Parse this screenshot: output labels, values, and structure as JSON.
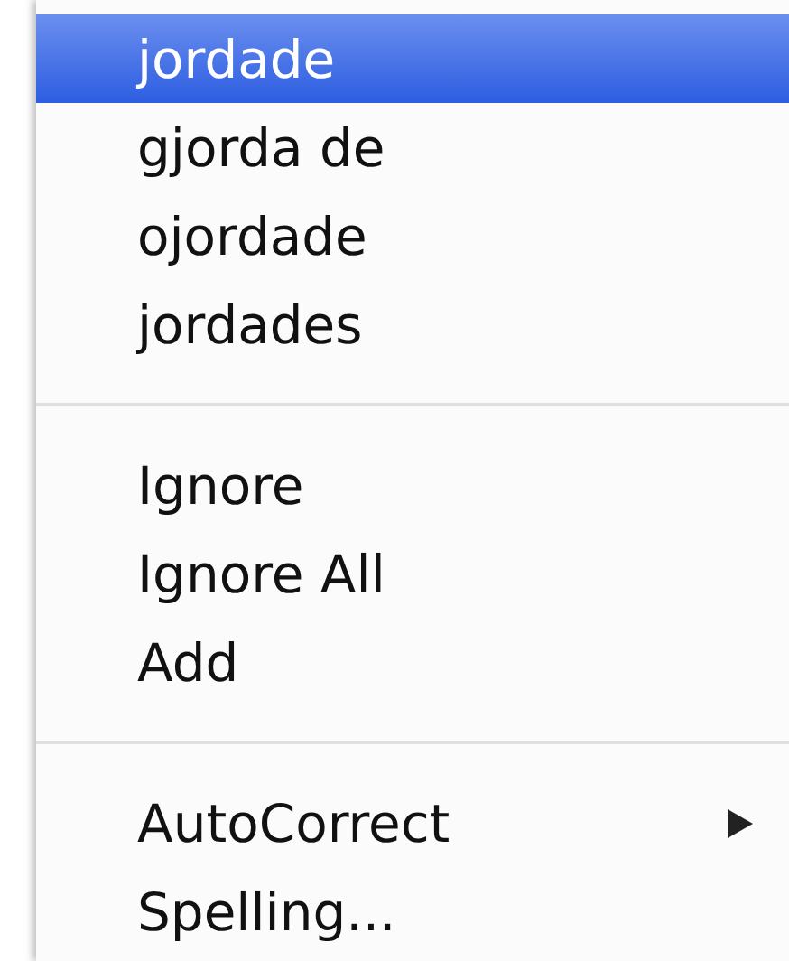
{
  "context_menu": {
    "items": [
      {
        "kind": "item",
        "label": "jordade",
        "selected": true
      },
      {
        "kind": "item",
        "label": "gjorda de",
        "selected": false
      },
      {
        "kind": "item",
        "label": "ojordade",
        "selected": false
      },
      {
        "kind": "item",
        "label": "jordades",
        "selected": false
      },
      {
        "kind": "separator"
      },
      {
        "kind": "item",
        "label": "Ignore",
        "selected": false
      },
      {
        "kind": "item",
        "label": "Ignore All",
        "selected": false
      },
      {
        "kind": "item",
        "label": "Add",
        "selected": false
      },
      {
        "kind": "separator"
      },
      {
        "kind": "submenu",
        "label": "AutoCorrect",
        "selected": false
      },
      {
        "kind": "item",
        "label": "Spelling...",
        "selected": false
      }
    ]
  }
}
